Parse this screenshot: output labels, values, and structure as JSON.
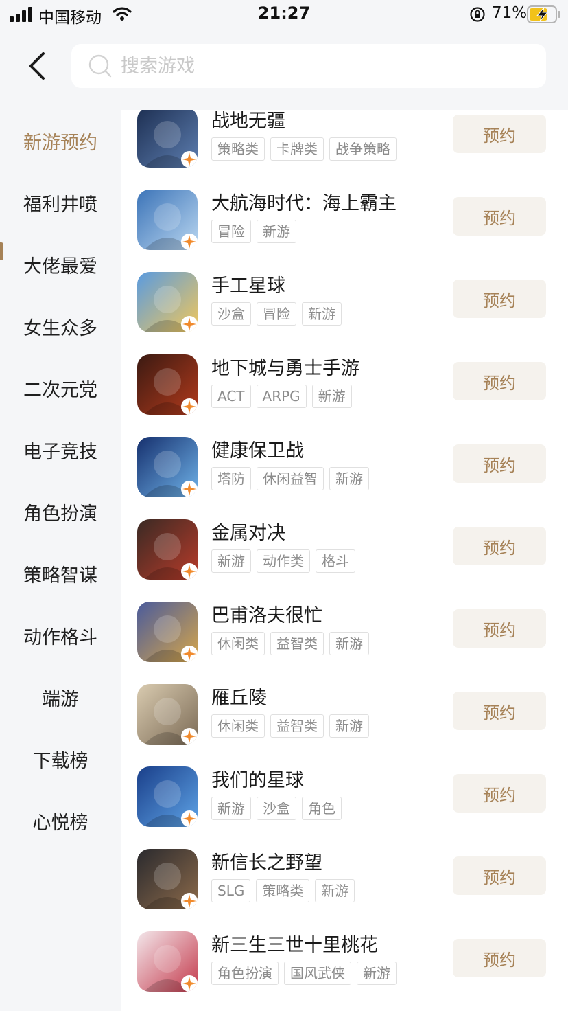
{
  "status_bar": {
    "carrier": "中国移动",
    "time": "21:27",
    "battery": "71%",
    "battery_level": 0.71
  },
  "search": {
    "placeholder": "搜索游戏"
  },
  "sidebar": {
    "items": [
      {
        "label": "新游预约",
        "active": true
      },
      {
        "label": "福利井喷"
      },
      {
        "label": "大佬最爱"
      },
      {
        "label": "女生众多"
      },
      {
        "label": "二次元党"
      },
      {
        "label": "电子竞技"
      },
      {
        "label": "角色扮演"
      },
      {
        "label": "策略智谋"
      },
      {
        "label": "动作格斗"
      },
      {
        "label": "端游"
      },
      {
        "label": "下载榜"
      },
      {
        "label": "心悦榜"
      }
    ]
  },
  "games": [
    {
      "title": "战地无疆",
      "tags": [
        "策略类",
        "卡牌类",
        "战争策略"
      ],
      "button": "预约",
      "colors": [
        "#1d2f52",
        "#5d7eb0"
      ]
    },
    {
      "title": "大航海时代：海上霸主",
      "tags": [
        "冒险",
        "新游"
      ],
      "button": "预约",
      "colors": [
        "#3c74b8",
        "#b9d6f0"
      ]
    },
    {
      "title": "手工星球",
      "tags": [
        "沙盒",
        "冒险",
        "新游"
      ],
      "button": "预约",
      "colors": [
        "#5a9be0",
        "#f1c75a"
      ]
    },
    {
      "title": "地下城与勇士手游",
      "tags": [
        "ACT",
        "ARPG",
        "新游"
      ],
      "button": "预约",
      "colors": [
        "#3b1a12",
        "#b23a1c"
      ]
    },
    {
      "title": "健康保卫战",
      "tags": [
        "塔防",
        "休闲益智",
        "新游"
      ],
      "button": "预约",
      "colors": [
        "#16306e",
        "#6fb2e8"
      ]
    },
    {
      "title": "金属对决",
      "tags": [
        "新游",
        "动作类",
        "格斗"
      ],
      "button": "预约",
      "colors": [
        "#3a2a24",
        "#b83b2a"
      ]
    },
    {
      "title": "巴甫洛夫很忙",
      "tags": [
        "休闲类",
        "益智类",
        "新游"
      ],
      "button": "预约",
      "colors": [
        "#4a5b9c",
        "#d6a64a"
      ]
    },
    {
      "title": "雁丘陵",
      "tags": [
        "休闲类",
        "益智类",
        "新游"
      ],
      "button": "预约",
      "colors": [
        "#d9cbb0",
        "#7b6a55"
      ]
    },
    {
      "title": "我们的星球",
      "tags": [
        "新游",
        "沙盒",
        "角色"
      ],
      "button": "预约",
      "colors": [
        "#1a3f8a",
        "#5ea3e6"
      ]
    },
    {
      "title": "新信长之野望",
      "tags": [
        "SLG",
        "策略类",
        "新游"
      ],
      "button": "预约",
      "colors": [
        "#2a2a2e",
        "#8c6a4a"
      ]
    },
    {
      "title": "新三生三世十里桃花",
      "tags": [
        "角色扮演",
        "国风武侠",
        "新游"
      ],
      "button": "预约",
      "colors": [
        "#f3e6ea",
        "#c43a4c"
      ]
    }
  ]
}
